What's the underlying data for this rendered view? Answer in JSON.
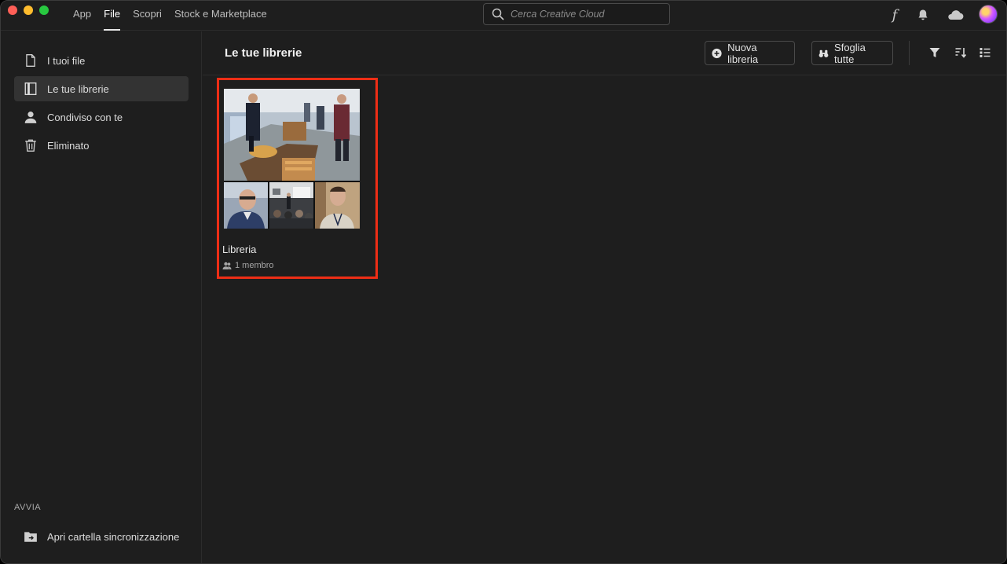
{
  "topnav": {
    "items": [
      {
        "label": "App"
      },
      {
        "label": "File",
        "active": true
      },
      {
        "label": "Scopri"
      },
      {
        "label": "Stock e Marketplace"
      }
    ]
  },
  "search": {
    "placeholder": "Cerca Creative Cloud"
  },
  "top_icons": [
    "fonts-icon",
    "bell-icon",
    "cloud-icon",
    "avatar"
  ],
  "sidebar": {
    "items": [
      {
        "label": "I tuoi file",
        "icon": "file-icon"
      },
      {
        "label": "Le tue librerie",
        "icon": "library-icon",
        "active": true
      },
      {
        "label": "Condiviso con te",
        "icon": "person-icon"
      },
      {
        "label": "Eliminato",
        "icon": "trash-icon"
      }
    ],
    "section_label": "AVVIA",
    "bottom_item": {
      "label": "Apri cartella sincronizzazione",
      "icon": "folder-sync-icon"
    }
  },
  "main": {
    "title": "Le tue librerie",
    "new_library_label": "Nuova libreria",
    "browse_all_label": "Sfoglia tutte",
    "tools": [
      "filter-icon",
      "sort-icon",
      "list-view-icon"
    ]
  },
  "library": {
    "name": "Libreria",
    "members": "1 membro",
    "highlight_color": "#ee2e16"
  },
  "colors": {
    "background": "#1e1e1e",
    "active_item": "#333333",
    "accent_red": "#ee2e16"
  }
}
